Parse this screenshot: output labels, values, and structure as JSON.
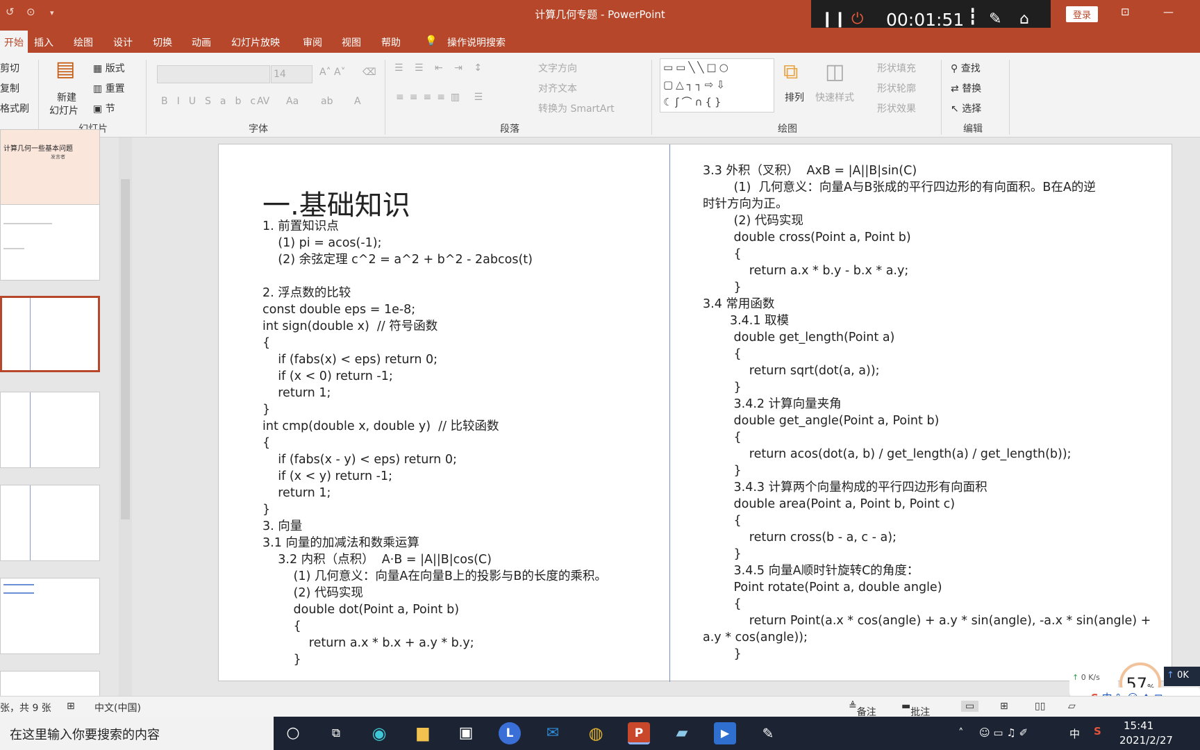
{
  "window": {
    "title": "计算几何专题 - PowerPoint",
    "signin": "登录"
  },
  "timer": {
    "time": "00:01:51"
  },
  "menu": {
    "tabs": [
      "开始",
      "插入",
      "绘图",
      "设计",
      "切换",
      "动画",
      "幻灯片放映",
      "审阅",
      "视图",
      "帮助"
    ],
    "search": "操作说明搜索"
  },
  "ribbon": {
    "clipboard": {
      "cut": "剪切",
      "copy": "复制",
      "painter": "格式刷"
    },
    "slides": {
      "new_line1": "新建",
      "new_line2": "幻灯片",
      "layout": "版式",
      "reset": "重置",
      "section": "节",
      "group": "幻灯片"
    },
    "font": {
      "size": "14",
      "group": "字体"
    },
    "paragraph": {
      "textdir": "文字方向",
      "align": "对齐文本",
      "smartart": "转换为 SmartArt",
      "group": "段落"
    },
    "drawing": {
      "arrange": "排列",
      "quick": "快速样式",
      "fill": "形状填充",
      "outline": "形状轮廓",
      "effect": "形状效果",
      "group": "绘图"
    },
    "editing": {
      "find": "查找",
      "replace": "替换",
      "select": "选择",
      "group": "编辑"
    }
  },
  "thumbnails": {
    "slide1_title": "计算几何一些基本问题",
    "slide1_sub": "发言者"
  },
  "slide": {
    "heading": "一.基础知识",
    "left_lines": [
      "1. 前置知识点",
      "    (1) pi = acos(-1);",
      "    (2) 余弦定理 c^2 = a^2 + b^2 - 2abcos(t)",
      "",
      "2. 浮点数的比较",
      "const double eps = 1e-8;",
      "int sign(double x)  // 符号函数",
      "{",
      "    if (fabs(x) < eps) return 0;",
      "    if (x < 0) return -1;",
      "    return 1;",
      "}",
      "int cmp(double x, double y)  // 比较函数",
      "{",
      "    if (fabs(x - y) < eps) return 0;",
      "    if (x < y) return -1;",
      "    return 1;",
      "}",
      "3. 向量",
      "3.1 向量的加减法和数乘运算",
      "    3.2 内积（点积）  A·B = |A||B|cos(C)",
      "        (1) 几何意义：向量A在向量B上的投影与B的长度的乘积。",
      "        (2) 代码实现",
      "        double dot(Point a, Point b)",
      "        {",
      "            return a.x * b.x + a.y * b.y;",
      "        }"
    ],
    "right_lines": [
      "3.3 外积（叉积）  AxB = |A||B|sin(C)",
      "        (1)  几何意义：向量A与B张成的平行四边形的有向面积。B在A的逆",
      "时针方向为正。",
      "        (2) 代码实现",
      "        double cross(Point a, Point b)",
      "        {",
      "            return a.x * b.y - b.x * a.y;",
      "        }",
      "3.4 常用函数",
      "       3.4.1 取模",
      "        double get_length(Point a)",
      "        {",
      "            return sqrt(dot(a, a));",
      "        }",
      "        3.4.2 计算向量夹角",
      "        double get_angle(Point a, Point b)",
      "        {",
      "            return acos(dot(a, b) / get_length(a) / get_length(b));",
      "        }",
      "        3.4.3 计算两个向量构成的平行四边形有向面积",
      "        double area(Point a, Point b, Point c)",
      "        {",
      "            return cross(b - a, c - a);",
      "        }",
      "        3.4.5 向量A顺时针旋转C的角度：",
      "        Point rotate(Point a, double angle)",
      "        {",
      "            return Point(a.x * cos(angle) + a.y * sin(angle), -a.x * sin(angle) +",
      "a.y * cos(angle));",
      "        }"
    ]
  },
  "statusbar": {
    "slidecount": "张，共 9 张",
    "language": "中文(中国)",
    "notes": "备注",
    "comments": "批注"
  },
  "overlay": {
    "zoom": "57",
    "net": "0  K/s",
    "net2": "0K",
    "ime": "中 °, ☺ ♦ ⊞"
  },
  "taskbar": {
    "search_placeholder": "在这里输入你要搜索的内容",
    "time": "15:41",
    "date": "2021/2/27",
    "ime": "中"
  }
}
